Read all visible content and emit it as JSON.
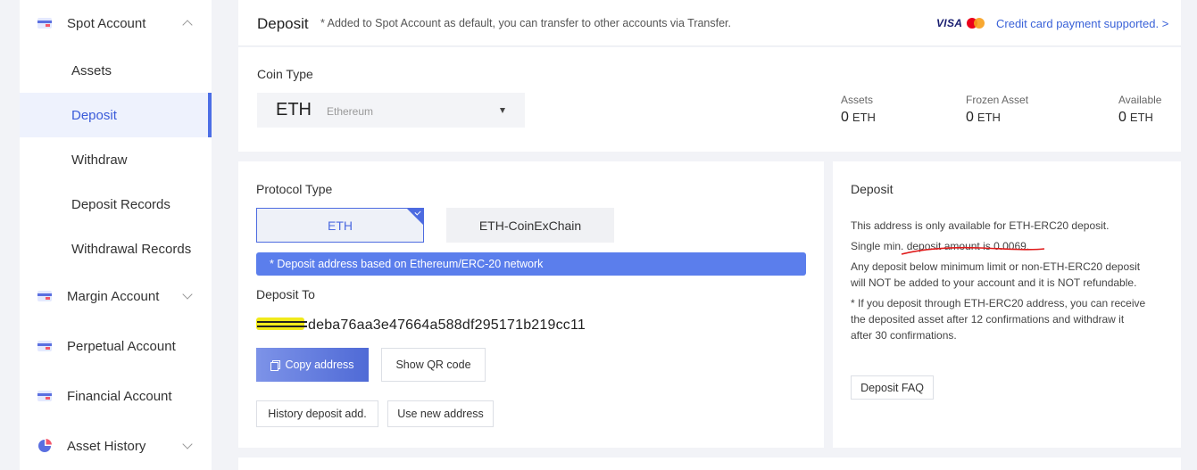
{
  "sidebar": {
    "spot_account": "Spot Account",
    "sub_items": [
      "Assets",
      "Deposit",
      "Withdraw",
      "Deposit Records",
      "Withdrawal Records"
    ],
    "margin_account": "Margin Account",
    "perpetual_account": "Perpetual Account",
    "financial_account": "Financial Account",
    "asset_history": "Asset History",
    "active_item": "Deposit"
  },
  "header": {
    "title": "Deposit",
    "note": "* Added to Spot Account as default, you can transfer to other accounts via Transfer.",
    "visa": "VISA",
    "card_link": "Credit card payment supported. >"
  },
  "coin": {
    "label": "Coin Type",
    "selected_symbol": "ETH",
    "selected_name": "Ethereum",
    "stats": [
      {
        "label": "Assets",
        "value": "0",
        "unit": "ETH"
      },
      {
        "label": "Frozen Asset",
        "value": "0",
        "unit": "ETH"
      },
      {
        "label": "Available",
        "value": "0",
        "unit": "ETH"
      }
    ]
  },
  "protocol": {
    "label": "Protocol Type",
    "options": [
      "ETH",
      "ETH-CoinExChain"
    ],
    "selected": "ETH",
    "banner": "* Deposit address based on Ethereum/ERC-20 network",
    "deposit_to_label": "Deposit To",
    "address_visible": "deba76aa3e47664a588df295171b219cc11",
    "copy_button": "Copy address",
    "qr_button": "Show QR code",
    "history_button": "History deposit add.",
    "new_address_button": "Use new address"
  },
  "info": {
    "title": "Deposit",
    "line1": "This address is only available for ETH-ERC20 deposit.",
    "line2": "Single min. deposit amount is 0.0069.",
    "line3a": "Any deposit below minimum limit or non-ETH-ERC20 deposit",
    "line3b": "will NOT be added to your account and it is NOT refundable.",
    "line4a": "* If you deposit through ETH-ERC20 address, you can receive",
    "line4b": "the deposited asset after 12 confirmations and withdraw it",
    "line4c": "after 30 confirmations.",
    "faq_button": "Deposit FAQ"
  },
  "colors": {
    "accent": "#4c6ee6",
    "banner": "#5b7eec",
    "annotation": "#e01b1b",
    "highlight": "#f1ea1a"
  }
}
